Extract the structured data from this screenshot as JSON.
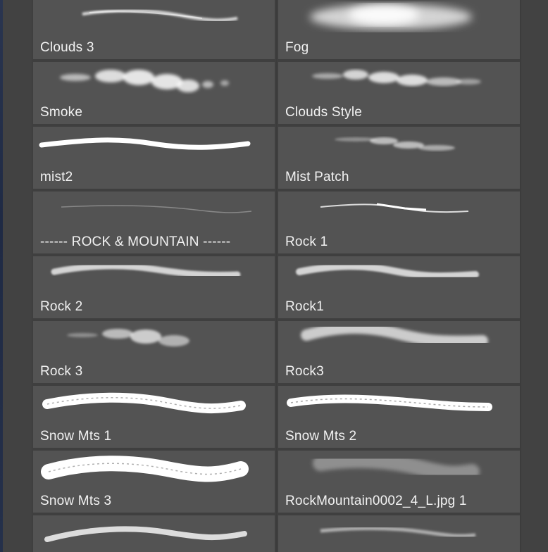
{
  "brush_panel": {
    "items": [
      {
        "label": "Clouds 3",
        "preview": "cloud-stroke-icon"
      },
      {
        "label": "Fog",
        "preview": "fog-stroke-icon"
      },
      {
        "label": "Smoke",
        "preview": "smoke-stroke-icon"
      },
      {
        "label": "Clouds Style",
        "preview": "clouds-style-stroke-icon"
      },
      {
        "label": "mist2",
        "preview": "mist-stroke-icon"
      },
      {
        "label": "Mist Patch",
        "preview": "mist-patch-stroke-icon"
      },
      {
        "label": "------ ROCK & MOUNTAIN ------",
        "preview": "separator-stroke-icon"
      },
      {
        "label": "Rock 1",
        "preview": "rock-stroke-icon"
      },
      {
        "label": "Rock 2",
        "preview": "rock-stroke-icon"
      },
      {
        "label": "Rock1",
        "preview": "rock-stroke-icon"
      },
      {
        "label": "Rock 3",
        "preview": "rock-stroke-icon"
      },
      {
        "label": "Rock3",
        "preview": "rock-stroke-icon"
      },
      {
        "label": "Snow Mts 1",
        "preview": "snow-mountain-stroke-icon"
      },
      {
        "label": "Snow Mts 2",
        "preview": "snow-mountain-stroke-icon"
      },
      {
        "label": "Snow Mts 3",
        "preview": "snow-mountain-stroke-icon"
      },
      {
        "label": "RockMountain0002_4_L.jpg 1",
        "preview": "rock-mountain-stroke-icon"
      },
      {
        "label": "",
        "preview": "brush-stroke-icon"
      },
      {
        "label": "",
        "preview": "brush-stroke-icon"
      }
    ]
  },
  "colors": {
    "tile_bg": "#535353",
    "tile_border": "#3f3f3f",
    "label_text": "#f2f2f2",
    "stroke": "#ffffff"
  }
}
